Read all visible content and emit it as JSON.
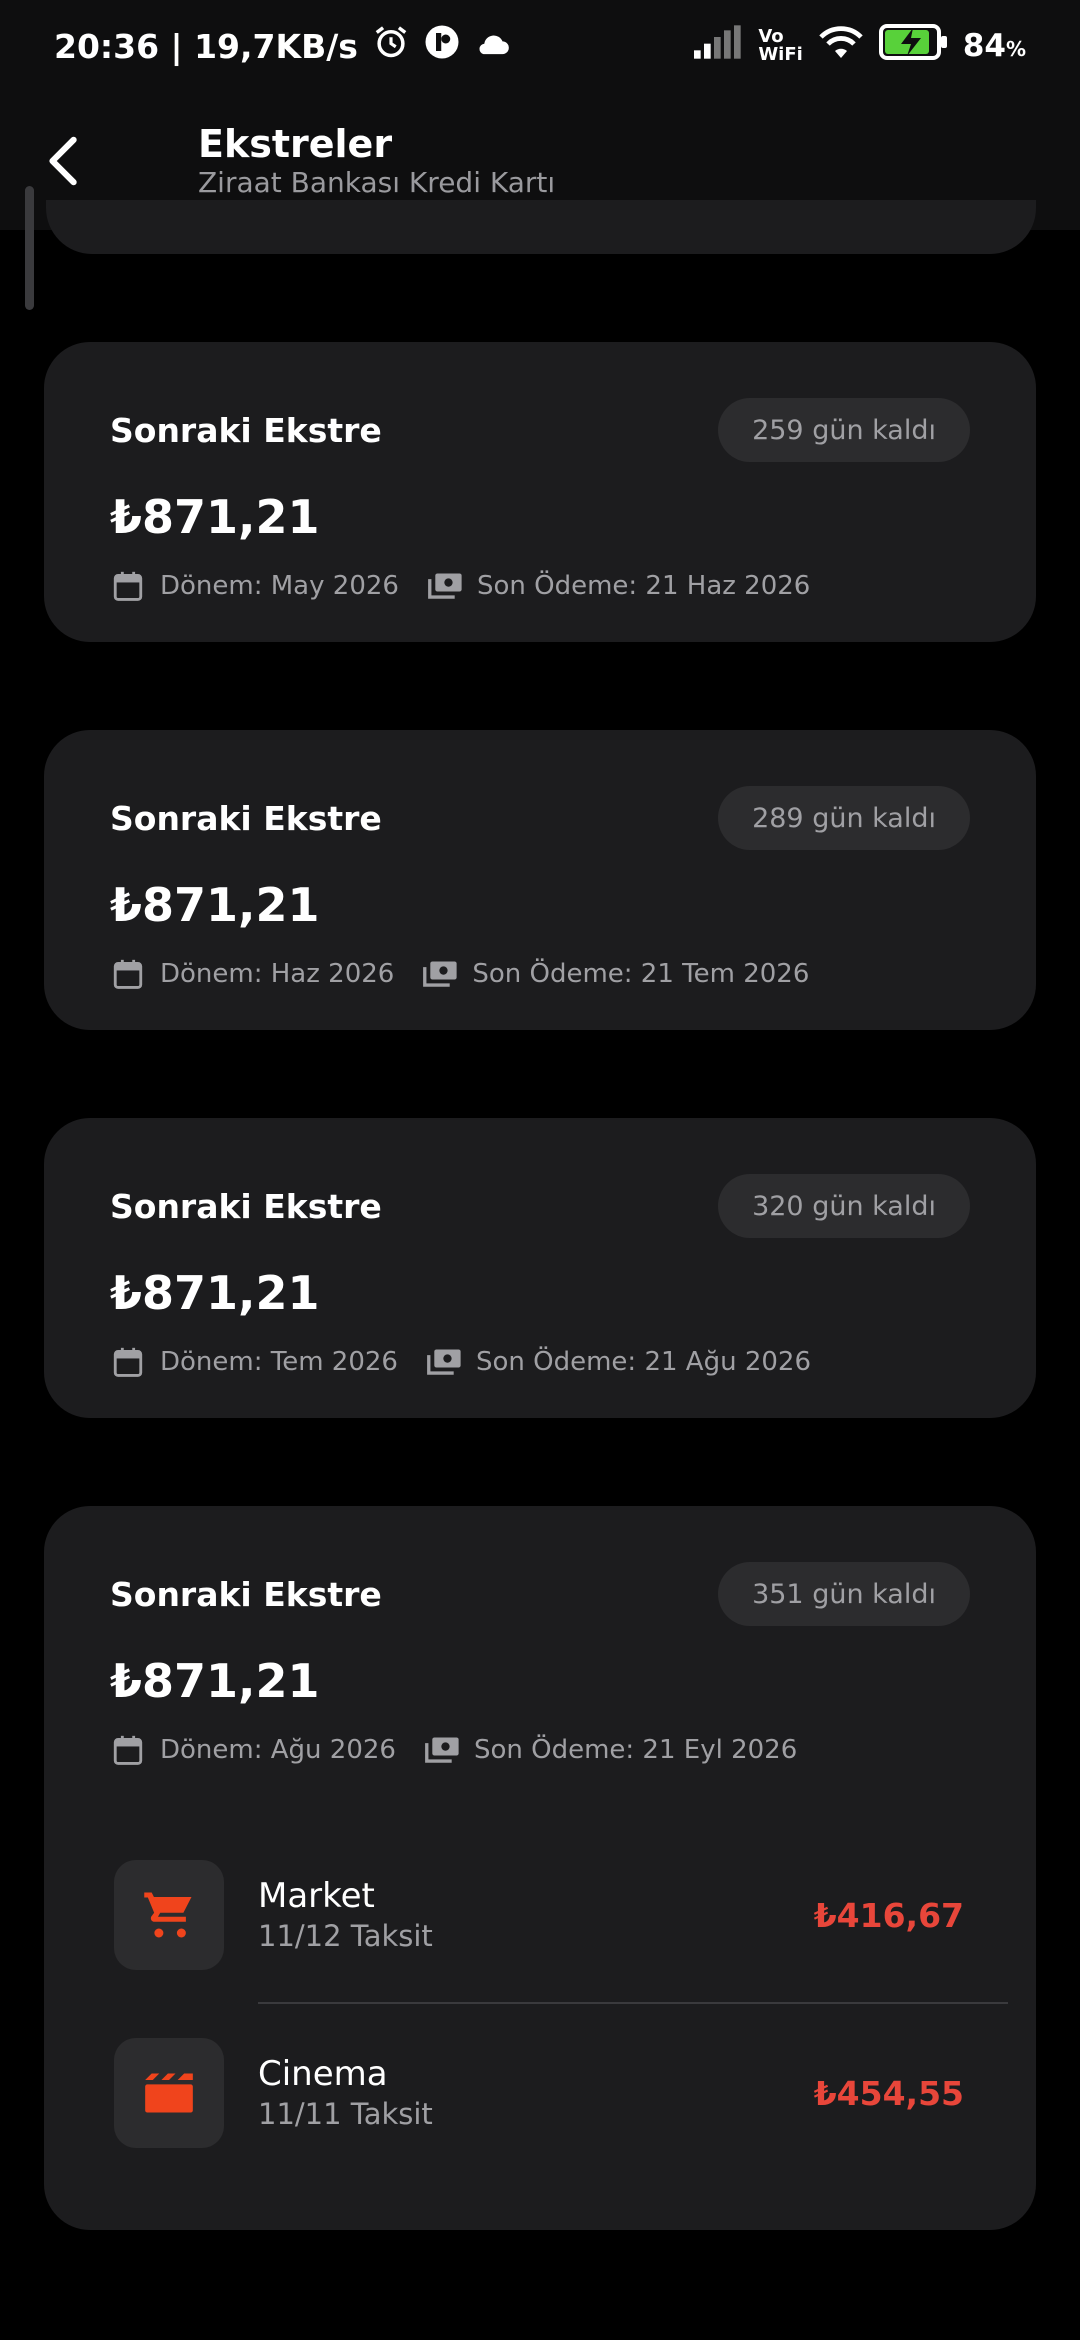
{
  "status_bar": {
    "time_speed": "20:36 | 19,7KB/s",
    "vowifi_top": "Vo",
    "vowifi_bottom": "WiFi",
    "battery": "84",
    "battery_unit": "%"
  },
  "app_bar": {
    "title": "Ekstreler",
    "subtitle": "Ziraat Bankası Kredi Kartı"
  },
  "cards": [
    {
      "title": "Sonraki Ekstre",
      "badge": "259 gün kaldı",
      "amount": "₺871,21",
      "period": "Dönem: May 2026",
      "due": "Son Ödeme: 21 Haz 2026"
    },
    {
      "title": "Sonraki Ekstre",
      "badge": "289 gün kaldı",
      "amount": "₺871,21",
      "period": "Dönem: Haz 2026",
      "due": "Son Ödeme: 21 Tem 2026"
    },
    {
      "title": "Sonraki Ekstre",
      "badge": "320 gün kaldı",
      "amount": "₺871,21",
      "period": "Dönem: Tem 2026",
      "due": "Son Ödeme: 21 Ağu 2026"
    },
    {
      "title": "Sonraki Ekstre",
      "badge": "351 gün kaldı",
      "amount": "₺871,21",
      "period": "Dönem: Ağu 2026",
      "due": "Son Ödeme: 21 Eyl 2026",
      "transactions": [
        {
          "name": "Market",
          "installment": "11/12 Taksit",
          "amount": "₺416,67",
          "icon": "cart-icon"
        },
        {
          "name": "Cinema",
          "installment": "11/11 Taksit",
          "amount": "₺454,55",
          "icon": "movie-clapper-icon"
        }
      ]
    }
  ],
  "colors": {
    "background": "#000000",
    "card": "#1c1c1e",
    "badge": "#2c2c2e",
    "amount_negative": "#e8463a",
    "icon_accent": "#f0441c",
    "battery_green": "#58d13a"
  }
}
